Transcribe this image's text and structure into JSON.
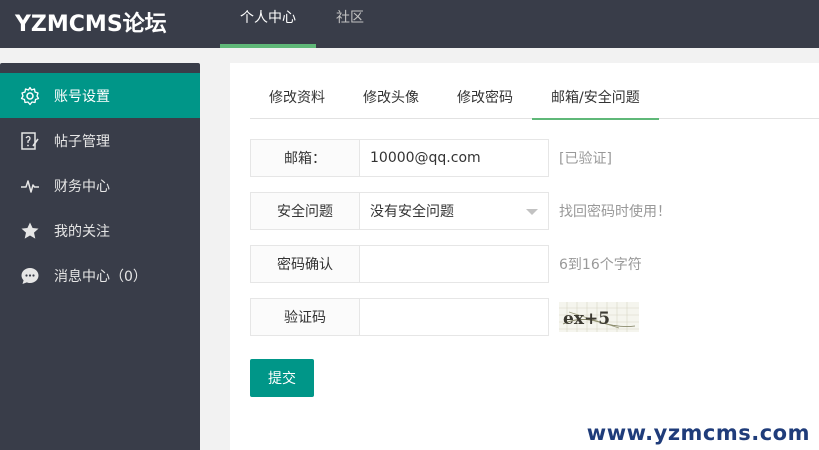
{
  "header": {
    "logo": "YZMCMS论坛",
    "nav": [
      {
        "label": "个人中心",
        "active": true
      },
      {
        "label": "社区",
        "active": false
      }
    ]
  },
  "sidebar": {
    "items": [
      {
        "label": "账号设置",
        "icon": "gear-icon",
        "active": true
      },
      {
        "label": "帖子管理",
        "icon": "post-edit-icon",
        "active": false
      },
      {
        "label": "财务中心",
        "icon": "pulse-icon",
        "active": false
      },
      {
        "label": "我的关注",
        "icon": "star-icon",
        "active": false
      },
      {
        "label": "消息中心（0）",
        "icon": "chat-icon",
        "active": false
      }
    ]
  },
  "tabs": [
    {
      "label": "修改资料",
      "active": false
    },
    {
      "label": "修改头像",
      "active": false
    },
    {
      "label": "修改密码",
      "active": false
    },
    {
      "label": "邮箱/安全问题",
      "active": true
    }
  ],
  "form": {
    "email": {
      "label": "邮箱：",
      "value": "10000@qq.com",
      "aux": "[已验证]"
    },
    "security_question": {
      "label": "安全问题",
      "value": "没有安全问题",
      "aux": "找回密码时使用！"
    },
    "password_confirm": {
      "label": "密码确认",
      "value": "",
      "aux": "6到16个字符"
    },
    "captcha": {
      "label": "验证码",
      "value": "",
      "image_text": "ex+5"
    },
    "submit_label": "提交"
  },
  "watermark": "www.yzmcms.com",
  "colors": {
    "topbar": "#393d49",
    "accent": "#009688",
    "tab_underline": "#5fb878",
    "watermark": "#1f3c7a"
  }
}
